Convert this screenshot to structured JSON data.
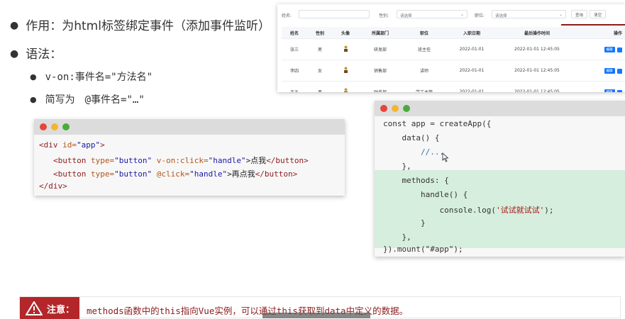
{
  "bullets": {
    "effect": "作用：为html标签绑定事件（添加事件监听）",
    "syntax": "语法：",
    "sub1": "v-on:事件名=\"方法名\"",
    "sub2_prefix": "简写为",
    "sub2_code": "@事件名=\"…\""
  },
  "table_shot": {
    "filters": {
      "name_label": "姓名:",
      "gender_label": "性别:",
      "gender_placeholder": "请选择",
      "position_label": "职位:",
      "position_placeholder": "请选择",
      "query_button": "查询",
      "clear_button": "清空"
    },
    "columns": [
      "姓名",
      "性别",
      "头像",
      "所属部门",
      "职位",
      "入职日期",
      "最后操作时间",
      "操作"
    ],
    "rows": [
      {
        "name": "张三",
        "gender": "男",
        "dept": "研发部",
        "position": "班主任",
        "date": "2022-01-01",
        "last": "2022-01-01 12:45:05",
        "op": "编辑"
      },
      {
        "name": "李四",
        "gender": "女",
        "dept": "销售部",
        "position": "讲师",
        "date": "2022-01-01",
        "last": "2022-01-01 12:45:05",
        "op": "编辑"
      },
      {
        "name": "王五",
        "gender": "男",
        "dept": "财务部",
        "position": "学工主管",
        "date": "2022-01-01",
        "last": "2022-01-01 12:45:05",
        "op": "编辑"
      }
    ]
  },
  "html_code": {
    "l1_open": "<div ",
    "l1_attr": "id=",
    "l1_val": "\"app\"",
    "l1_close": ">",
    "l2_open": "<button ",
    "l2_attr1": "type=",
    "l2_val1": "\"button\"",
    "l2_attr2": " v-on:click=",
    "l2_val2": "\"handle\"",
    "l2_text": ">点我",
    "l2_close": "</button>",
    "l3_open": "<button ",
    "l3_attr1": "type=",
    "l3_val1": "\"button\"",
    "l3_attr2": " @click=",
    "l3_val2": "\"handle\"",
    "l3_text": ">再点我",
    "l3_close": "</button>",
    "l4": "</div>"
  },
  "js_code": {
    "l1": "const app = createApp({",
    "l2": "    data() {",
    "l3": "        //...",
    "l4": "    },",
    "l5": "    methods: {",
    "l6": "        handle() {",
    "l7_pre": "            console.log(",
    "l7_str": "'试试就试试'",
    "l7_post": ");",
    "l8": "        }",
    "l9": "    },",
    "l10": "}).mount(\"#app\");"
  },
  "note": {
    "label": "注意：",
    "message": "methods函数中的this指向Vue实例，可以通过this获取到data中定义的数据。"
  }
}
